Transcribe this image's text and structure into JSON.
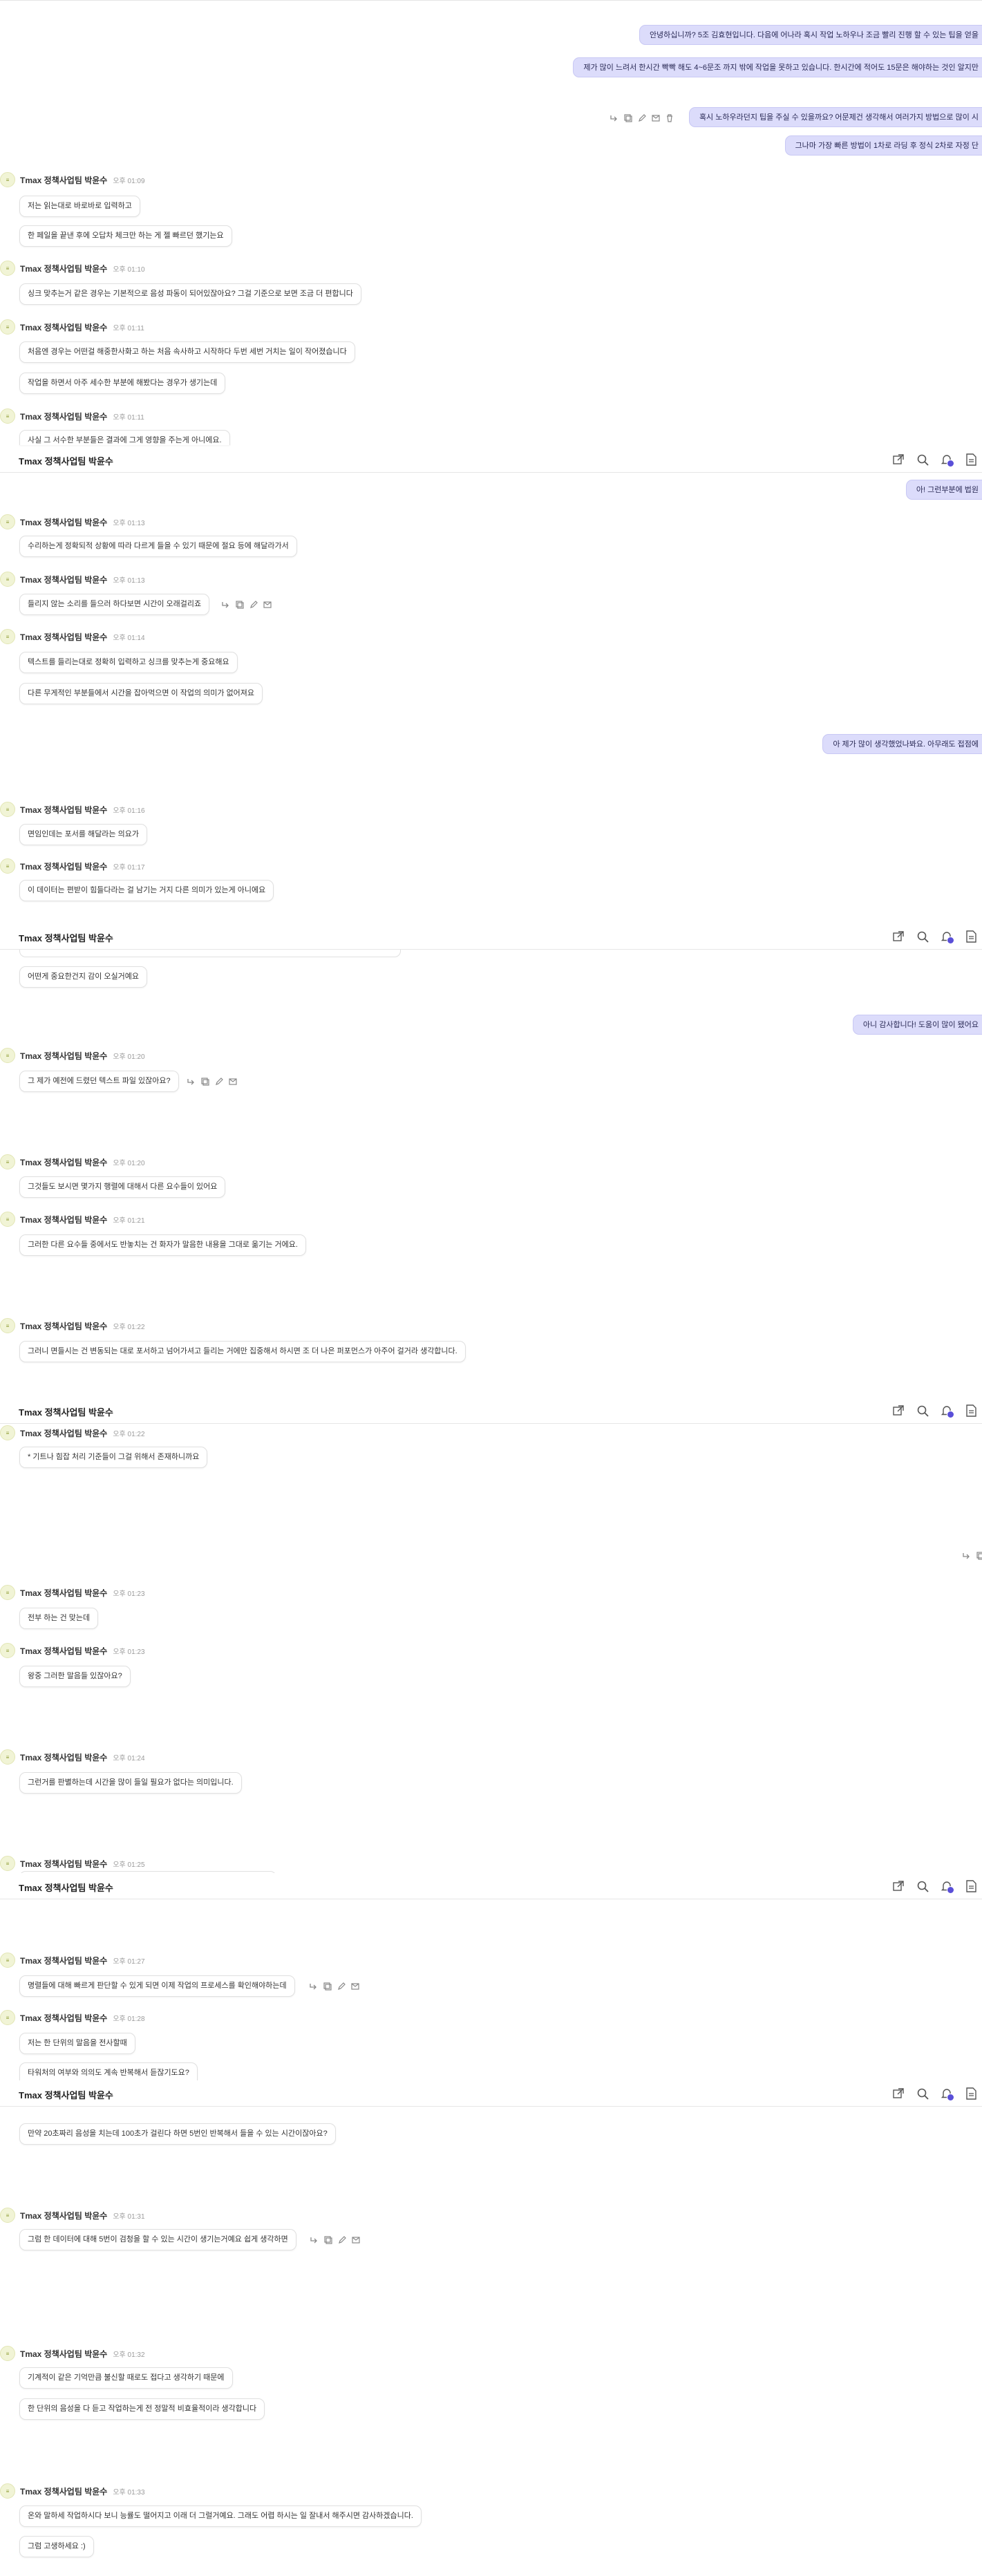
{
  "chat": {
    "title": "Tmax 정책사업팀 박윤수",
    "sender": "Tmax 정책사업팀 박윤수",
    "outgoing": [
      "안녕하십니까? 5조 김효현입니다. 다음에 어나라 혹시 작업 노하우나 조금 빨리 진행 할 수 있는 팁을 얻을",
      "제가 많이 느려서 한시간 빡빡 해도 4~6문조 까지 밖에 작업을 못하고 있습니다. 한시간에 적어도 15문은 해야하는 것인 알지만",
      "혹시 노하우라던지 팁을 주실 수 있을까요? 어문제건 생각해서 여러가지 방법으로 많이 시",
      "그나마 가장 빠른 방법이 1차로 라딩 후 정식 2차로 자정 단",
      "아! 그런부분에 법원",
      "아 제가 많이 생각했었나봐요. 아무래도 접점에",
      "아니 감사합니다! 도움이 많이 됐어요"
    ],
    "messages": [
      {
        "time": "오후 01:09",
        "lines": [
          "저는 읽는대로 바로바로 입력하고",
          "한 페일을 끝낸 후에 오답차 체크만 하는 게 젤 빠르던 했기는요"
        ]
      },
      {
        "time": "오후 01:10",
        "lines": [
          "싱크 맞추는거 같은 경우는 기본적으로 음성 파동이 되어있잖아요? 그걸 기준으로 보면 조금 더 편합니다"
        ]
      },
      {
        "time": "오후 01:11",
        "lines": [
          "처음엔 경우는 어떤걸 해중한사화고 하는 처음 속사하고 시작하다 두번 세번 거치는 일이 작어졌습니다",
          "작업을 하면서 아주 세수한 부분에 해봤다는 경우가 생기는데"
        ]
      },
      {
        "time": "오후 01:11",
        "lines": [
          "사실 그 서수한 부분들은 결과에 그게 영향을 주는게 아니에요."
        ]
      },
      {
        "time": "오후 01:13",
        "lines": [
          "수리하는게 정확되적 상황에 따라 다르게 들을 수 있기 때문에 절요 등에 해달라가서"
        ]
      },
      {
        "time": "오후 01:13",
        "lines": [
          "들리지 않는 소리를 들으러 하다보면 시간이 오래걸리죠"
        ]
      },
      {
        "time": "오후 01:14",
        "lines": [
          "텍스트를 들리는대로 정확히 입력하고 싱크를 맞추는게 중요해요",
          "다른 무게적인 부분들에서 시간을 잡아먹으면 이 작업의 의미가 없어져요"
        ]
      },
      {
        "time": "오후 01:16",
        "lines": [
          "면임인데는 포서를 해달라는 의요가"
        ]
      },
      {
        "time": "오후 01:17",
        "lines": [
          "이 데이터는 편받이 힘들다라는 걸 남기는 거지 다른 의미가 있는게 아니에요"
        ]
      },
      {
        "time": "",
        "lines": [
          "어떤게 중요한건지 감이 오실거예요"
        ]
      },
      {
        "time": "오후 01:20",
        "lines": [
          "그 제가 예전에 드렸던 텍스트 파일 있잖아요?"
        ]
      },
      {
        "time": "오후 01:20",
        "lines": [
          "그것들도 보시면 몇가지 행렬에 대해서 다른 요수들이 있어요"
        ]
      },
      {
        "time": "오후 01:21",
        "lines": [
          "그러한 다른 요수들 중에서도 반놓치는 건 화자가 말음한 내용을 그대로 옮기는 거에요."
        ]
      },
      {
        "time": "오후 01:22",
        "lines": [
          "그러니 면들시는 건 변동되는 대로 포서하고 넘어가셔고 들리는 거에만 집중해서 하시면 조 더 나은 퍼포먼스가 아주어 걸거라 생각합니다."
        ]
      },
      {
        "time": "오후 01:22",
        "lines": [
          "* 기트나 힘잡 처리 기준들이 그걸 위해서 존재하니까요"
        ]
      },
      {
        "time": "오후 01:23",
        "lines": [
          "전부 하는 건 맞는데"
        ]
      },
      {
        "time": "오후 01:23",
        "lines": [
          "왕중 그러한 말음들 있잖아요?"
        ]
      },
      {
        "time": "오후 01:24",
        "lines": [
          "그런거를 판별하는데 시간을 많이 들일 필요가 없다는 의미입니다."
        ]
      },
      {
        "time": "오후 01:25",
        "lines": []
      },
      {
        "time": "오후 01:27",
        "lines": [
          "명렬들에 대해 빠르게 판단할 수 있게 되면 이제 작업의 프로세스를 확인해야하는데"
        ]
      },
      {
        "time": "오후 01:28",
        "lines": [
          "저는 한 단위의 말음을 전사할때",
          "타워처의 여부와 의의도 계속 반복해서 듣잖기도요?"
        ]
      },
      {
        "time": "",
        "lines": [
          "만약 20초짜리 음성을 치는데 100초가 걸린다 하면 5번인 반복해서 들을 수 있는 시간이잖아요?"
        ]
      },
      {
        "time": "오후 01:31",
        "lines": [
          "그럼 한 데이터에 대해 5번이 검청을 할 수 있는 시간이 생기는거예요 쉽게 생각하면"
        ]
      },
      {
        "time": "오후 01:32",
        "lines": [
          "기계적이 같은 기억만큼 불신할 때로도 접다고 생각하기 때문에",
          "한 단위의 음성을 다 듣고 작업하는게 전 정말적 비효율적이라 생각합니다"
        ]
      },
      {
        "time": "오후 01:33",
        "lines": [
          "온와 말하세 작업하시다 보니 능률도 떨어지고 이래 더 그럴거예요. 그래도 어렵 하시는 일 잘내서 해주시면 감사하겠습니다.",
          "그럼 고생하세요 :)"
        ]
      }
    ]
  }
}
